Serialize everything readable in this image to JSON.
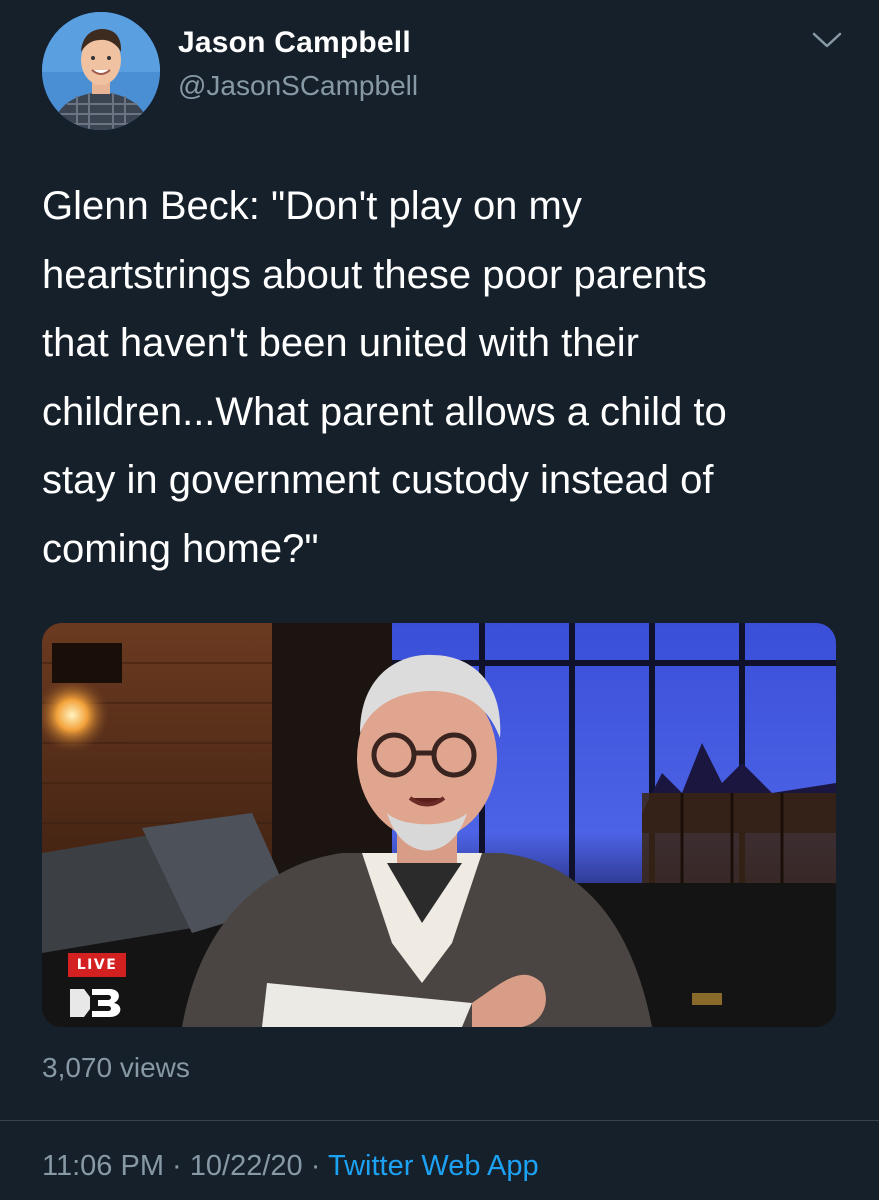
{
  "author": {
    "display_name": "Jason Campbell",
    "handle": "@JasonSCampbell",
    "avatar_icon": "profile-photo"
  },
  "header": {
    "menu_icon": "chevron-down-icon"
  },
  "tweet": {
    "text": "Glenn Beck: \"Don't play on my\nheartstrings about these poor parents\nthat haven't been united with their\nchildren...What parent allows a child to\nstay in government custody instead of\ncoming home?\""
  },
  "media": {
    "type": "video",
    "live_label": "LIVE",
    "brand_icon": "blaze-logo-icon"
  },
  "stats": {
    "views": "3,070 views"
  },
  "meta": {
    "time": "11:06 PM",
    "separator": "·",
    "date": "10/22/20",
    "source": "Twitter Web App"
  },
  "colors": {
    "background": "#15202b",
    "text_primary": "#ffffff",
    "text_secondary": "#8899a6",
    "link": "#1da1f2",
    "live_badge": "#d32121",
    "divider": "#38444d"
  }
}
